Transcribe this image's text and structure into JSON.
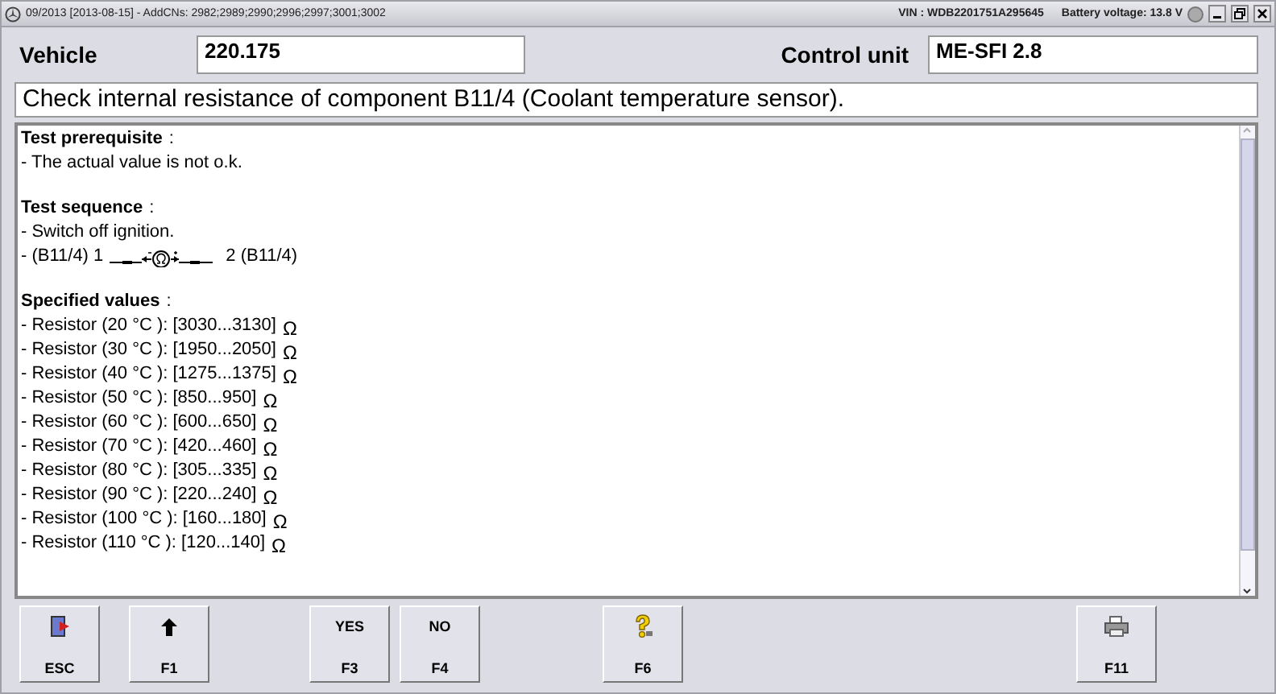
{
  "window": {
    "title": "09/2013 [2013-08-15] - AddCNs: 2982;2989;2990;2996;2997;3001;3002",
    "vin": "VIN : WDB2201751A295645",
    "battery": "Battery voltage: 13.8 V"
  },
  "header": {
    "vehicle_label": "Vehicle",
    "vehicle_value": "220.175",
    "control_unit_label": "Control unit",
    "control_unit_value": "ME-SFI 2.8"
  },
  "instruction": "Check internal resistance of component B11/4 (Coolant temperature sensor).",
  "sections": [
    {
      "heading": "Test prerequisite",
      "colon": ":",
      "lines": [
        {
          "kind": "text",
          "text": "- The actual value is not o.k."
        }
      ]
    },
    {
      "heading": "Test sequence",
      "colon": ":",
      "lines": [
        {
          "kind": "text",
          "text": "- Switch off ignition."
        },
        {
          "kind": "circuit",
          "left": "- (B11/4) 1",
          "right": "2 (B11/4)"
        }
      ]
    },
    {
      "heading": "Specified values",
      "colon": ":",
      "lines": [
        {
          "kind": "value",
          "text": "- Resistor (20 °C ): [3030...3130]",
          "unit": "Ω"
        },
        {
          "kind": "value",
          "text": "- Resistor (30 °C ): [1950...2050]",
          "unit": "Ω"
        },
        {
          "kind": "value",
          "text": "- Resistor (40 °C ): [1275...1375]",
          "unit": "Ω"
        },
        {
          "kind": "value",
          "text": "- Resistor (50 °C ): [850...950]",
          "unit": "Ω"
        },
        {
          "kind": "value",
          "text": "- Resistor (60 °C ): [600...650]",
          "unit": "Ω"
        },
        {
          "kind": "value",
          "text": "- Resistor (70 °C ): [420...460]",
          "unit": "Ω"
        },
        {
          "kind": "value",
          "text": "- Resistor (80 °C ): [305...335]",
          "unit": "Ω"
        },
        {
          "kind": "value",
          "text": "- Resistor (90 °C ): [220...240]",
          "unit": "Ω"
        },
        {
          "kind": "value",
          "text": "- Resistor (100 °C ): [160...180]",
          "unit": "Ω"
        },
        {
          "kind": "value",
          "text": "- Resistor (110 °C ): [120...140]",
          "unit": "Ω"
        }
      ]
    }
  ],
  "buttons": [
    {
      "kind": "exit",
      "key": "ESC"
    },
    {
      "kind": "up",
      "key": "F1"
    },
    {
      "kind": "text",
      "top": "YES",
      "key": "F3"
    },
    {
      "kind": "text",
      "top": "NO",
      "key": "F4"
    },
    {
      "kind": "help",
      "key": "F6"
    },
    {
      "kind": "print",
      "key": "F11"
    }
  ]
}
